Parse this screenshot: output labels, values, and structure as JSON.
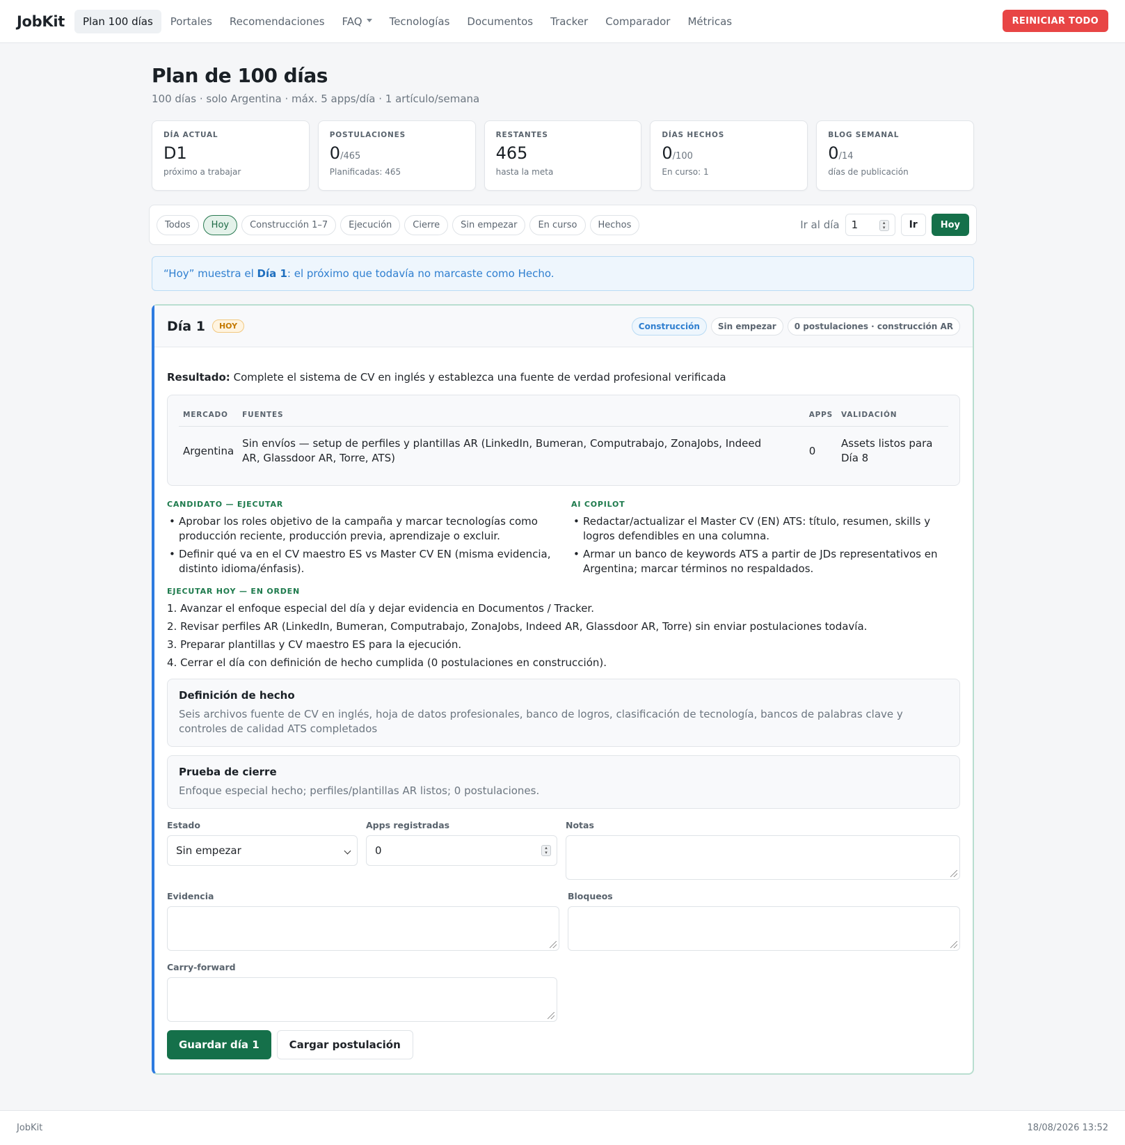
{
  "nav": {
    "brand": "JobKit",
    "items": [
      {
        "label": "Plan 100 días"
      },
      {
        "label": "Portales"
      },
      {
        "label": "Recomendaciones"
      },
      {
        "label": "FAQ"
      },
      {
        "label": "Tecnologías"
      },
      {
        "label": "Documentos"
      },
      {
        "label": "Tracker"
      },
      {
        "label": "Comparador"
      },
      {
        "label": "Métricas"
      }
    ],
    "reset_label": "REINICIAR TODO"
  },
  "page": {
    "title": "Plan de 100 días",
    "subtitle": "100 días · solo Argentina · máx. 5 apps/día · 1 artículo/semana"
  },
  "stats": [
    {
      "label": "DÍA ACTUAL",
      "value": "D1",
      "denom": "",
      "sub": "próximo a trabajar"
    },
    {
      "label": "POSTULACIONES",
      "value": "0",
      "denom": "/465",
      "sub": "Planificadas: 465"
    },
    {
      "label": "RESTANTES",
      "value": "465",
      "denom": "",
      "sub": "hasta la meta"
    },
    {
      "label": "DÍAS HECHOS",
      "value": "0",
      "denom": "/100",
      "sub": "En curso: 1"
    },
    {
      "label": "BLOG SEMANAL",
      "value": "0",
      "denom": "/14",
      "sub": "días de publicación"
    }
  ],
  "filters": {
    "chips": [
      "Todos",
      "Hoy",
      "Construcción 1–7",
      "Ejecución",
      "Cierre",
      "Sin empezar",
      "En curso",
      "Hechos"
    ],
    "goto_label": "Ir al día",
    "goto_value": "1",
    "ir_label": "Ir",
    "hoy_label": "Hoy"
  },
  "info": {
    "prefix": "“Hoy” muestra el ",
    "bold": "Día 1",
    "suffix": ": el próximo que todavía no marcaste como Hecho."
  },
  "day": {
    "title": "Día 1",
    "badge": "HOY",
    "tags": [
      "Construcción",
      "Sin empezar",
      "0 postulaciones · construcción AR"
    ],
    "resultado_label": "Resultado:",
    "resultado_text": "Complete el sistema de CV en inglés y establezca una fuente de verdad profesional verificada",
    "table": {
      "headers": [
        "MERCADO",
        "FUENTES",
        "APPS",
        "VALIDACIÓN"
      ],
      "row": [
        "Argentina",
        "Sin envíos — setup de perfiles y plantillas AR (LinkedIn, Bumeran, Computrabajo, ZonaJobs, Indeed AR, Glassdoor AR, Torre, ATS)",
        "0",
        "Assets listos para Día 8"
      ]
    },
    "candidato_label": "CANDIDATO — EJECUTAR",
    "candidato_items": [
      "Aprobar los roles objetivo de la campaña y marcar tecnologías como producción reciente, producción previa, aprendizaje o excluir.",
      "Definir qué va en el CV maestro ES vs Master CV EN (misma evidencia, distinto idioma/énfasis)."
    ],
    "copilot_label": "AI COPILOT",
    "copilot_items": [
      "Redactar/actualizar el Master CV (EN) ATS: título, resumen, skills y logros defendibles en una columna.",
      "Armar un banco de keywords ATS a partir de JDs representativos en Argentina; marcar términos no respaldados."
    ],
    "orden_label": "EJECUTAR HOY — EN ORDEN",
    "orden_items": [
      "1. Avanzar el enfoque especial del día y dejar evidencia en Documentos / Tracker.",
      "2. Revisar perfiles AR (LinkedIn, Bumeran, Computrabajo, ZonaJobs, Indeed AR, Glassdoor AR, Torre) sin enviar postulaciones todavía.",
      "3. Preparar plantillas y CV maestro ES para la ejecución.",
      "4. Cerrar el día con definición de hecho cumplida (0 postulaciones en construcción)."
    ],
    "definicion_title": "Definición de hecho",
    "definicion_text": "Seis archivos fuente de CV en inglés, hoja de datos profesionales, banco de logros, clasificación de tecnología, bancos de palabras clave y controles de calidad ATS completados",
    "prueba_title": "Prueba de cierre",
    "prueba_text": "Enfoque especial hecho; perfiles/plantillas AR listos; 0 postulaciones.",
    "form": {
      "estado_label": "Estado",
      "estado_value": "Sin empezar",
      "apps_label": "Apps registradas",
      "apps_value": "0",
      "notas_label": "Notas",
      "evidencia_label": "Evidencia",
      "bloqueos_label": "Bloqueos",
      "carry_label": "Carry-forward"
    },
    "save_label": "Guardar día 1",
    "load_label": "Cargar postulación"
  },
  "footer": {
    "brand": "JobKit",
    "timestamp": "18/08/2026 13:52"
  }
}
